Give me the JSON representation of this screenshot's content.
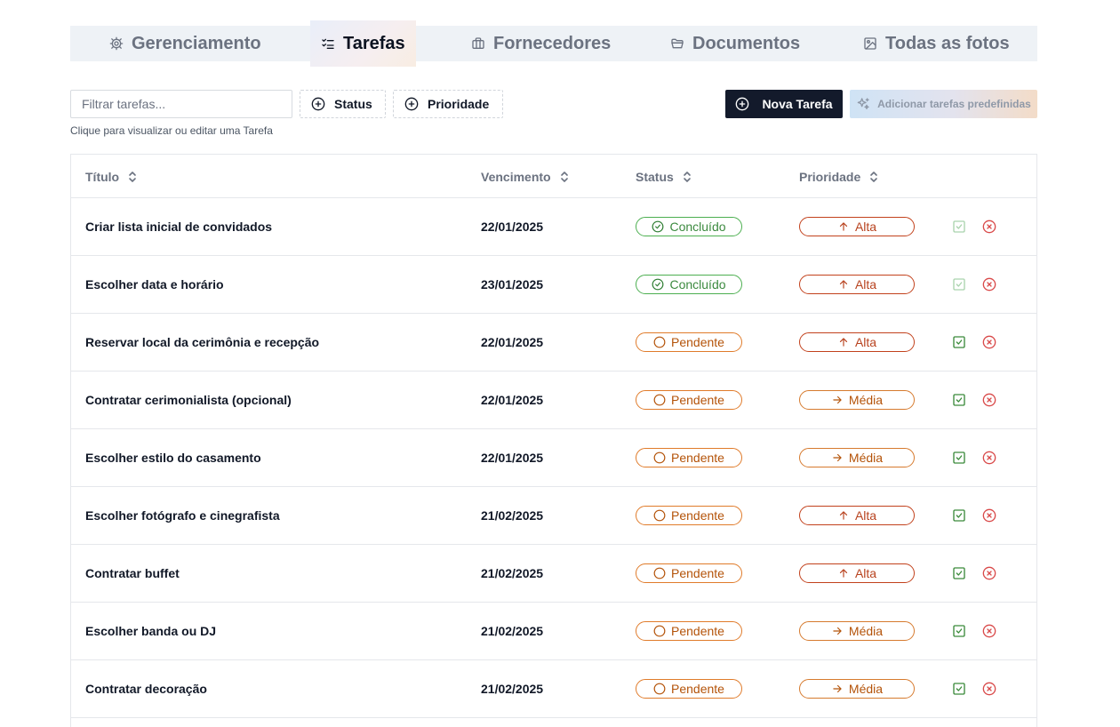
{
  "tabs": [
    {
      "label": "Gerenciamento",
      "icon": "gear-icon"
    },
    {
      "label": "Tarefas",
      "icon": "list-checks-icon"
    },
    {
      "label": "Fornecedores",
      "icon": "briefcase-icon"
    },
    {
      "label": "Documentos",
      "icon": "folder-icon"
    },
    {
      "label": "Todas as fotos",
      "icon": "image-icon"
    }
  ],
  "active_tab": "Tarefas",
  "toolbar": {
    "filter_placeholder": "Filtrar tarefas...",
    "filter_value": "",
    "status_label": "Status",
    "priority_label": "Prioridade",
    "hint": "Clique para visualizar ou editar uma Tarefa",
    "new_task_label": "Nova Tarefa",
    "preset_label": "Adicionar tarefas predefinidas"
  },
  "table": {
    "columns": {
      "title": "Título",
      "due": "Vencimento",
      "status": "Status",
      "priority": "Prioridade"
    },
    "rows": [
      {
        "title": "Criar lista inicial de convidados",
        "due": "22/01/2025",
        "status": "Concluído",
        "priority": "Alta"
      },
      {
        "title": "Escolher data e horário",
        "due": "23/01/2025",
        "status": "Concluído",
        "priority": "Alta"
      },
      {
        "title": "Reservar local da cerimônia e recepção",
        "due": "22/01/2025",
        "status": "Pendente",
        "priority": "Alta"
      },
      {
        "title": "Contratar cerimonialista (opcional)",
        "due": "22/01/2025",
        "status": "Pendente",
        "priority": "Média"
      },
      {
        "title": "Escolher estilo do casamento",
        "due": "22/01/2025",
        "status": "Pendente",
        "priority": "Média"
      },
      {
        "title": "Escolher fotógrafo e cinegrafista",
        "due": "21/02/2025",
        "status": "Pendente",
        "priority": "Alta"
      },
      {
        "title": "Contratar buffet",
        "due": "21/02/2025",
        "status": "Pendente",
        "priority": "Alta"
      },
      {
        "title": "Escolher banda ou DJ",
        "due": "21/02/2025",
        "status": "Pendente",
        "priority": "Média"
      },
      {
        "title": "Contratar decoração",
        "due": "21/02/2025",
        "status": "Pendente",
        "priority": "Média"
      }
    ]
  },
  "colors": {
    "primary_button": "#131a2b",
    "done_green": "#4caf50",
    "pending_orange": "#e07b2a",
    "high_red": "#c2411c",
    "delete_red": "#d94a4a"
  }
}
